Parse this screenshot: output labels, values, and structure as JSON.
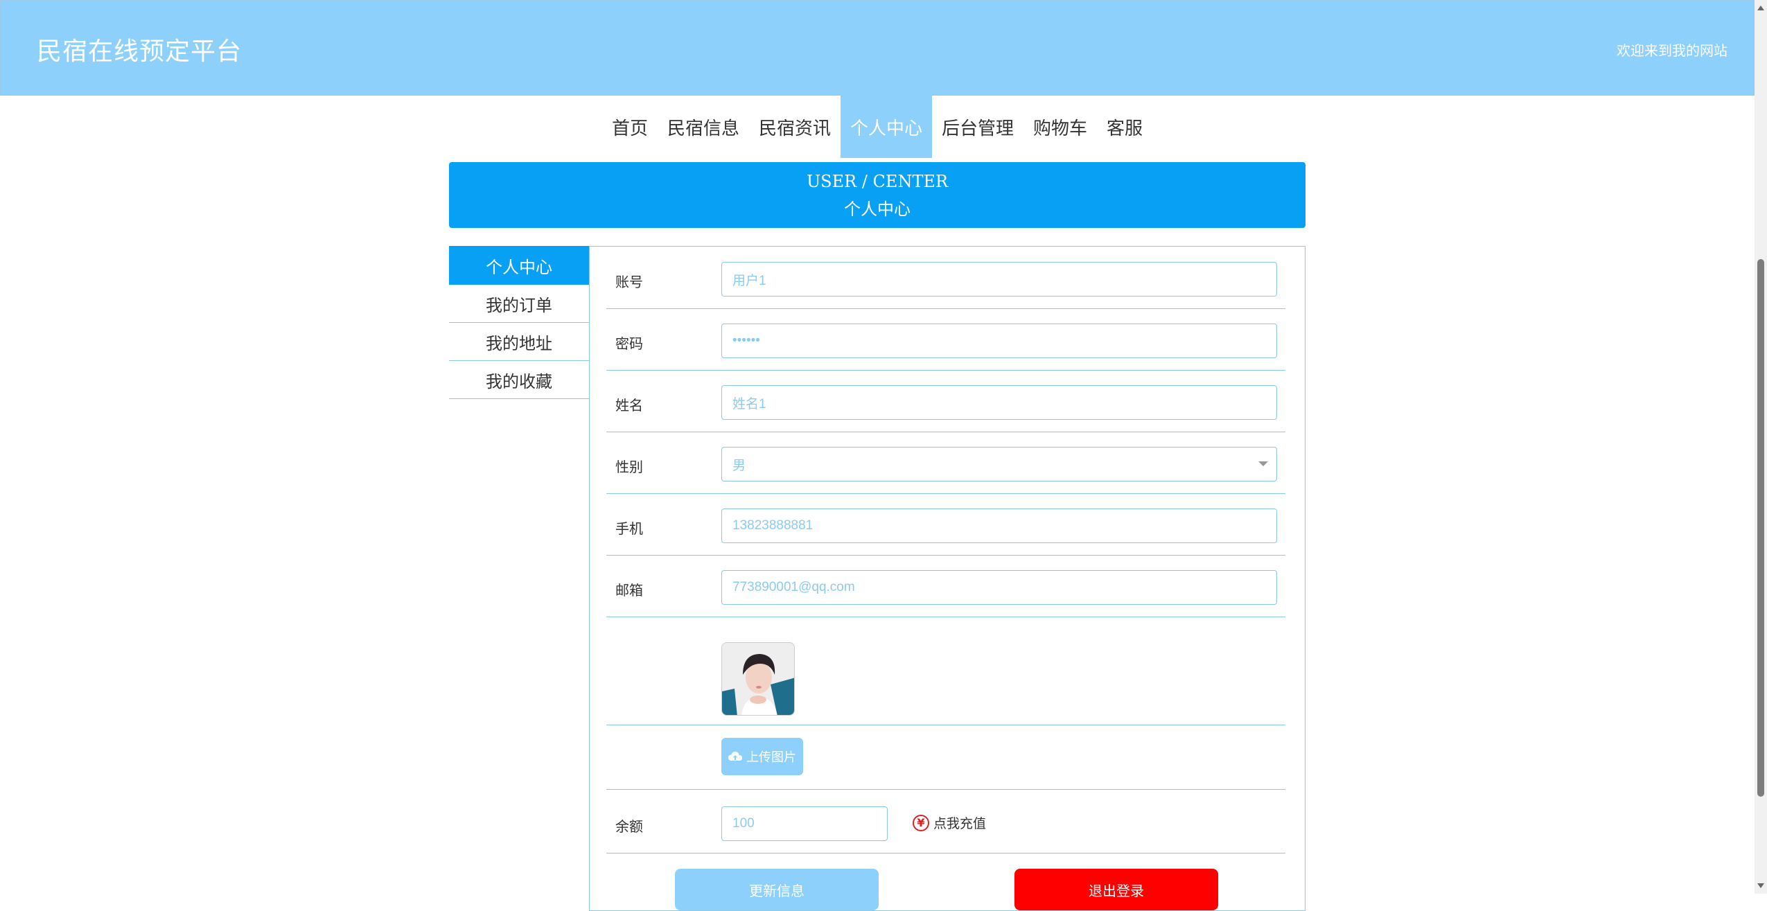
{
  "header": {
    "title": "民宿在线预定平台",
    "welcome": "欢迎来到我的网站"
  },
  "nav": {
    "items": [
      {
        "label": "首页"
      },
      {
        "label": "民宿信息"
      },
      {
        "label": "民宿资讯"
      },
      {
        "label": "个人中心",
        "active": true
      },
      {
        "label": "后台管理"
      },
      {
        "label": "购物车"
      },
      {
        "label": "客服"
      }
    ]
  },
  "banner": {
    "en": "USER / CENTER",
    "cn": "个人中心"
  },
  "sidebar": {
    "items": [
      {
        "label": "个人中心",
        "active": true
      },
      {
        "label": "我的订单"
      },
      {
        "label": "我的地址"
      },
      {
        "label": "我的收藏"
      }
    ]
  },
  "form": {
    "account": {
      "label": "账号",
      "value": "用户1"
    },
    "password": {
      "label": "密码",
      "value": "••••••"
    },
    "name": {
      "label": "姓名",
      "value": "姓名1"
    },
    "gender": {
      "label": "性别",
      "value": "男"
    },
    "phone": {
      "label": "手机",
      "value": "13823888881"
    },
    "email": {
      "label": "邮箱",
      "value": "773890001@qq.com"
    },
    "upload_label": "上传图片",
    "balance": {
      "label": "余额",
      "value": "100"
    },
    "recharge_label": "点我充值",
    "yen_symbol": "¥",
    "update_label": "更新信息",
    "logout_label": "退出登录"
  },
  "colors": {
    "header_bg": "#8dd0fb",
    "accent": "#07a0f5",
    "logout": "#ff0000"
  }
}
